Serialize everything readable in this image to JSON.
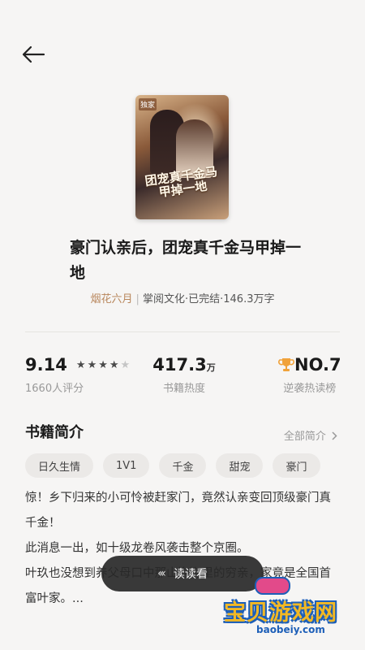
{
  "header": {
    "back_icon": "arrow-left-icon"
  },
  "book": {
    "cover_badge": "独家",
    "cover_title": "团宠真千金马甲掉一地",
    "title": "豪门认亲后，团宠真千金马甲掉一地",
    "author": "烟花六月",
    "publisher": "掌阅文化",
    "status": "已完结",
    "word_count": "146.3万字"
  },
  "stats": {
    "rating": {
      "value": "9.14",
      "stars": 4.5,
      "label": "1660人评分"
    },
    "popularity": {
      "value": "417.3",
      "unit": "万",
      "label": "书籍热度"
    },
    "rank": {
      "icon": "trophy-icon",
      "value": "NO.7",
      "label": "逆袭热读榜"
    }
  },
  "intro": {
    "title": "书籍简介",
    "all_label": "全部简介",
    "tags": [
      "日久生情",
      "1V1",
      "千金",
      "甜宠",
      "豪门"
    ],
    "lines": [
      "惊！乡下归来的小可怜被赶家门，竟然认亲变回顶级豪门真千金！",
      "此消息一出，如十级龙卷风袭击整个京圈。",
      "叶玖也没想到养父母口中那山沟沟里的穷亲，家竟是全国首富叶家。..."
    ]
  },
  "read_button": {
    "label": "读读看",
    "icon": "chevrons-left-icon"
  },
  "watermark": {
    "text": "宝贝游戏网",
    "url": "baobeiy.com"
  },
  "colors": {
    "author": "#b8865b",
    "trophy": "#f0a23a",
    "background": "#f6f5f4"
  }
}
